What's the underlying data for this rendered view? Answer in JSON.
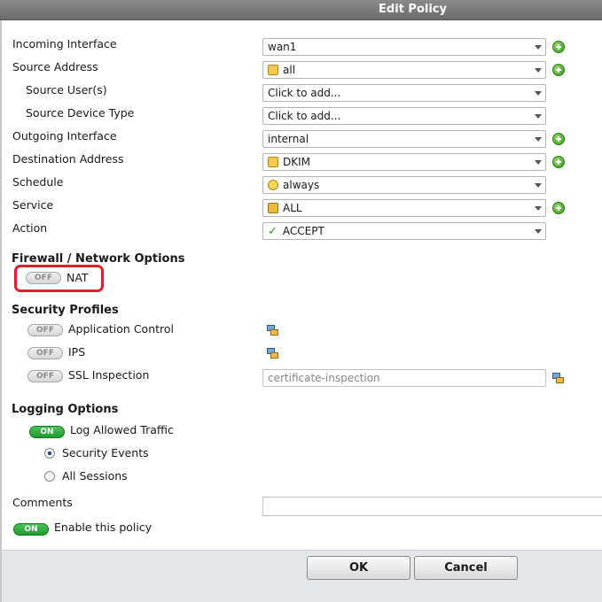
{
  "window": {
    "title": "Edit Policy"
  },
  "policy": {
    "incoming_interface": {
      "label": "Incoming Interface",
      "value": "wan1"
    },
    "source_address": {
      "label": "Source Address",
      "value": "all"
    },
    "source_users": {
      "label": "Source User(s)",
      "value": "Click to add..."
    },
    "source_device_type": {
      "label": "Source Device Type",
      "value": "Click to add..."
    },
    "outgoing_interface": {
      "label": "Outgoing Interface",
      "value": "internal"
    },
    "destination_address": {
      "label": "Destination Address",
      "value": "DKIM"
    },
    "schedule": {
      "label": "Schedule",
      "value": "always"
    },
    "service": {
      "label": "Service",
      "value": "ALL"
    },
    "action": {
      "label": "Action",
      "value": "ACCEPT"
    }
  },
  "firewall_options": {
    "heading": "Firewall / Network Options",
    "nat": {
      "label": "NAT",
      "state": "OFF"
    }
  },
  "security_profiles": {
    "heading": "Security Profiles",
    "application_control": {
      "label": "Application Control",
      "state": "OFF"
    },
    "ips": {
      "label": "IPS",
      "state": "OFF"
    },
    "ssl_inspection": {
      "label": "SSL Inspection",
      "state": "OFF",
      "value": "certificate-inspection"
    }
  },
  "logging": {
    "heading": "Logging Options",
    "log_allowed": {
      "label": "Log Allowed Traffic",
      "state": "ON"
    },
    "options": [
      {
        "label": "Security Events",
        "selected": true
      },
      {
        "label": "All Sessions",
        "selected": false
      }
    ]
  },
  "comments": {
    "label": "Comments",
    "value": ""
  },
  "enable": {
    "label": "Enable this policy",
    "state": "ON"
  },
  "buttons": {
    "ok": "OK",
    "cancel": "Cancel"
  },
  "colors": {
    "accent_green": "#1f9a2e",
    "highlight_red": "#e0202a",
    "titlebar": "#7a7a7a"
  },
  "icons": {
    "add": "plus-circle-icon",
    "address": "address-object-icon",
    "schedule": "schedule-icon",
    "service": "service-icon",
    "action": "checkmark-icon",
    "profile": "profile-settings-icon"
  }
}
